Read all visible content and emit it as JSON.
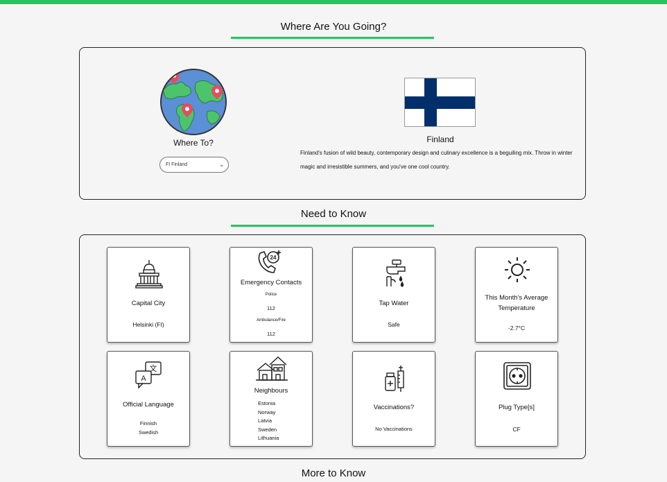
{
  "header": {
    "title": "Where Are You Going?"
  },
  "destination": {
    "where_to_label": "Where To?",
    "selected_country": "FI Finland",
    "country_name": "Finland",
    "description": "Finland's fusion of wild beauty, contemporary design and culinary excellence is a beguiling mix. Throw in winter magic and irresistible summers, and you've one cool country.",
    "colors": {
      "flag_blue": "#002f6c",
      "flag_white": "#ffffff"
    }
  },
  "need_to_know": {
    "title": "Need to Know",
    "cards": {
      "capital": {
        "icon": "capitol-building-icon",
        "title": "Capital City",
        "value": "Helsinki (FI)"
      },
      "emergency": {
        "icon": "24-hour-phone-icon",
        "title": "Emergency Contacts",
        "police_label": "Police",
        "police_number": "112",
        "ambulance_label": "Ambulance/Fire",
        "ambulance_number": "112"
      },
      "water": {
        "icon": "water-tap-icon",
        "title": "Tap Water",
        "value": "Safe"
      },
      "temperature": {
        "icon": "sun-icon",
        "title": "This Month's Average Temperature",
        "value": "-2.7°C"
      },
      "language": {
        "icon": "translate-icon",
        "title": "Official Language",
        "values": [
          "Finnish",
          "Swedish"
        ]
      },
      "neighbours": {
        "icon": "houses-icon",
        "title": "Neighbours",
        "values": [
          "Estonia",
          "Norway",
          "Latvia",
          "Sweden",
          "Lithuania"
        ]
      },
      "vaccinations": {
        "icon": "vaccine-icon",
        "title": "Vaccinations?",
        "value": "No Vaccinations"
      },
      "plug": {
        "icon": "power-socket-icon",
        "title": "Plug Type[s]",
        "value": "CF"
      }
    }
  },
  "more_to_know": {
    "title": "More to Know"
  },
  "colors": {
    "accent": "#22c55e",
    "marker": "#e94b5c",
    "land": "#4cc46b",
    "ocean": "#5b8fd6"
  }
}
